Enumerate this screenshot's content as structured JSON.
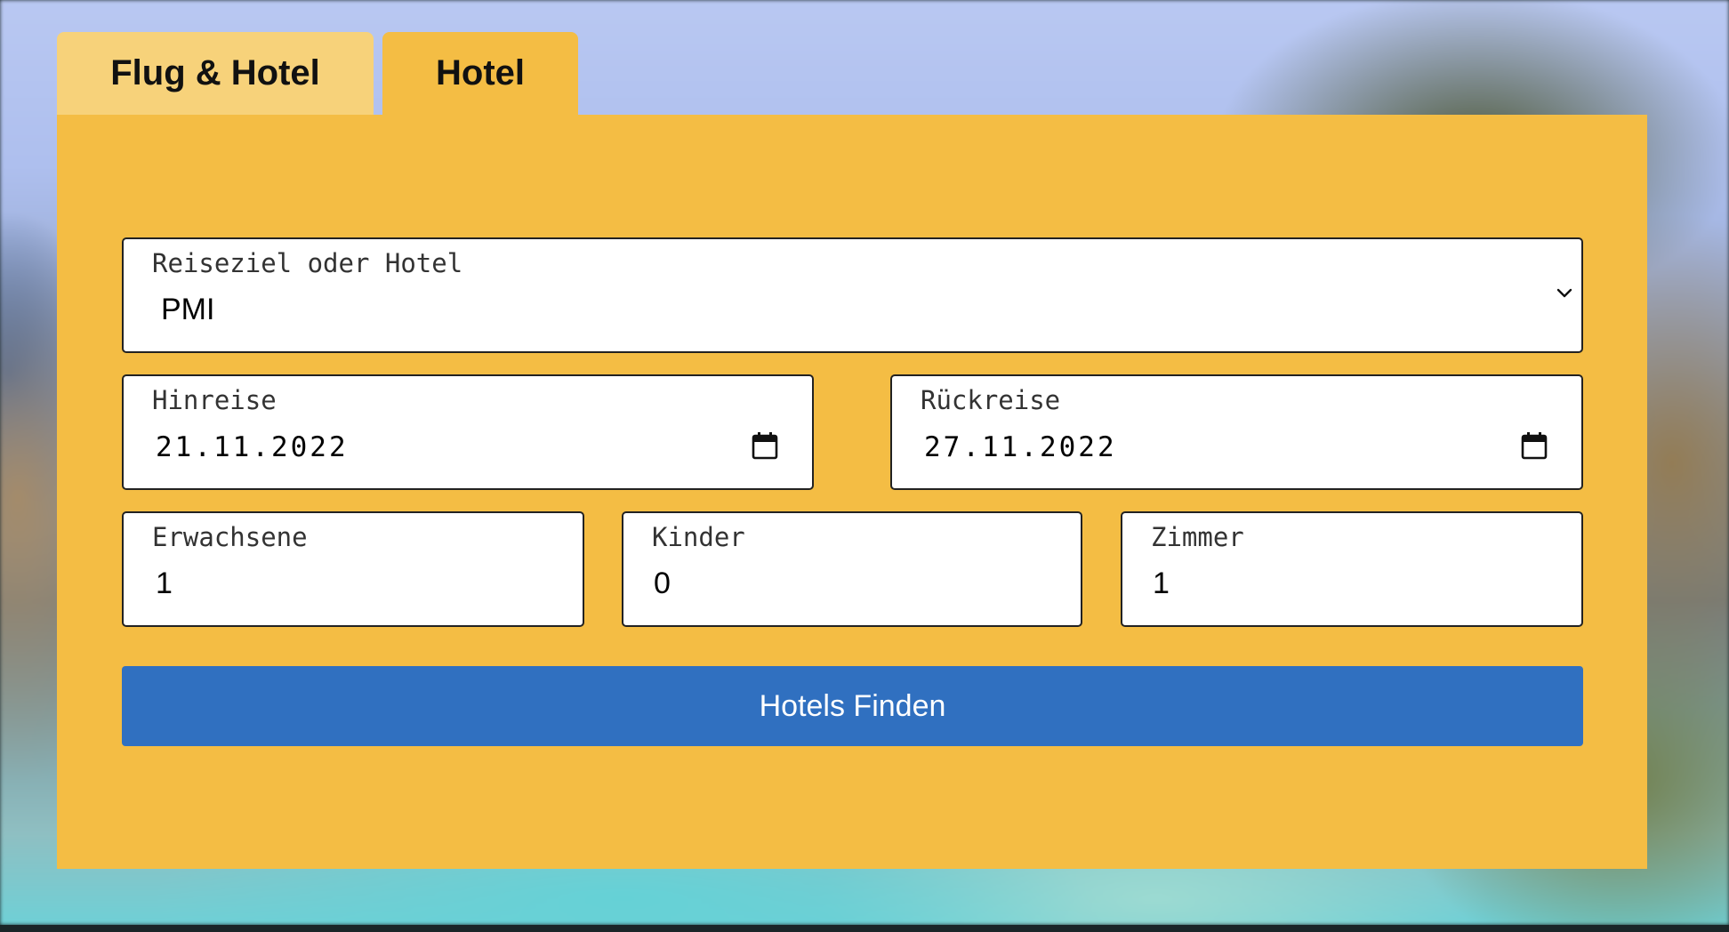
{
  "tabs": [
    {
      "label": "Flug & Hotel",
      "active": false
    },
    {
      "label": "Hotel",
      "active": true
    }
  ],
  "form": {
    "destination": {
      "label": "Reiseziel oder Hotel",
      "value": "PMI"
    },
    "departure": {
      "label": "Hinreise",
      "value": "21.11.2022"
    },
    "return": {
      "label": "Rückreise",
      "value": "27.11.2022"
    },
    "adults": {
      "label": "Erwachsene",
      "value": "1"
    },
    "children": {
      "label": "Kinder",
      "value": "0"
    },
    "rooms": {
      "label": "Zimmer",
      "value": "1"
    },
    "submit_label": "Hotels Finden"
  },
  "colors": {
    "panel": "#f4bd44",
    "inactive_tab": "#f7d27a",
    "button": "#3070c0"
  },
  "icons": {
    "dropdown": "chevron-down-icon",
    "date_picker": "calendar-icon"
  }
}
